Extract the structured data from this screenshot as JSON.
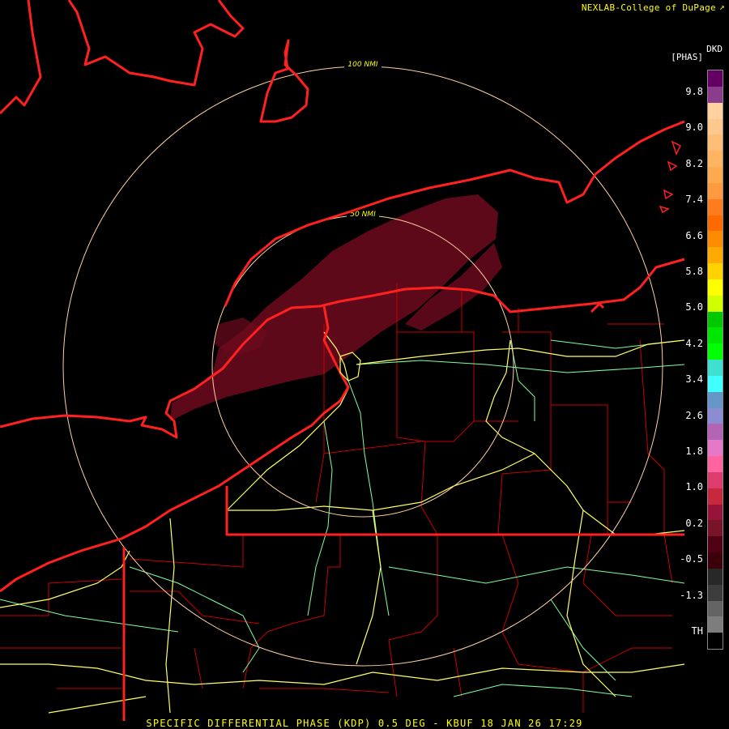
{
  "header": {
    "credit": "NEXLAB-College of DuPage",
    "credit_icon": "external-link-icon"
  },
  "legend": {
    "product_code": "DKD",
    "units": "[PHAS]",
    "labels": [
      "9.8",
      "9.0",
      "8.2",
      "7.4",
      "6.6",
      "5.8",
      "5.0",
      "4.2",
      "3.4",
      "2.6",
      "1.8",
      "1.0",
      "0.2",
      "-0.5",
      "-1.3",
      "TH"
    ],
    "colors": [
      "#640064",
      "#8c3c8c",
      "#ffd2a0",
      "#ffc88c",
      "#ffbe78",
      "#ffb464",
      "#ffaa50",
      "#ff9a40",
      "#ff7c1e",
      "#ff6a00",
      "#ff8c00",
      "#ffaa00",
      "#ffd200",
      "#ffff00",
      "#d2ff00",
      "#00c800",
      "#00e600",
      "#00ff00",
      "#40e0d0",
      "#40ffff",
      "#6496c8",
      "#8c8cd2",
      "#b464b4",
      "#e678c8",
      "#ff64a0",
      "#dc3c6e",
      "#c8283c",
      "#96143c",
      "#781428",
      "#500014",
      "#3c000a",
      "#282828",
      "#3c3c3c",
      "#646464",
      "#7d7d7d",
      "#000000"
    ]
  },
  "range_rings": [
    {
      "label": "100 NMI"
    },
    {
      "label": "50 NMI"
    }
  ],
  "footer": {
    "title": "SPECIFIC DIFFERENTIAL PHASE (KDP) 0.5 DEG - KBUF 18 JAN 26 17:29"
  },
  "colors": {
    "background": "#000000",
    "state_border": "#ff2020",
    "county_border": "#c80000",
    "highway": "#ffff66",
    "road": "#80ff9c",
    "range_ring": "#ffd0a0",
    "echo": "#6e0a1e",
    "text": "#ffff00"
  }
}
